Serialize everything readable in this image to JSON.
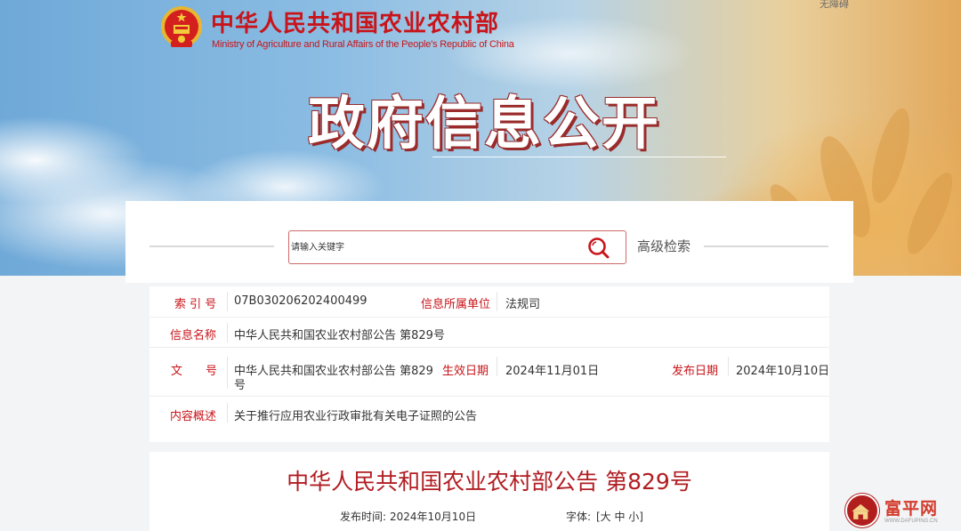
{
  "header": {
    "accessibility_link": "无障碍",
    "logo_cn": "中华人民共和国农业农村部",
    "logo_en": "Ministry of Agriculture and Rural Affairs of the People's Republic of China",
    "banner_title": "政府信息公开"
  },
  "search": {
    "placeholder": "请输入关键字",
    "advanced_label": "高级检索"
  },
  "info": {
    "index_label": "索 引 号",
    "index_value": "07B030206202400499",
    "unit_label": "信息所属单位",
    "unit_value": "法规司",
    "name_label": "信息名称",
    "name_value": "中华人民共和国农业农村部公告 第829号",
    "doc_label": "文　　号",
    "doc_value_line1": "中华人民共和国农业农村部公告 第829",
    "doc_value_line2": "号",
    "effective_label": "生效日期",
    "effective_value": "2024年11月01日",
    "publish_label": "发布日期",
    "publish_value": "2024年10月10日",
    "summary_label": "内容概述",
    "summary_value": "关于推行应用农业行政审批有关电子证照的公告"
  },
  "article": {
    "title": "中华人民共和国农业农村部公告 第829号",
    "pub_time_label": "发布时间:",
    "pub_time_value": "2024年10月10日",
    "font_label": "字体:",
    "font_controls": "[大 中 小]"
  },
  "watermark": {
    "text": "富平网",
    "url": "WWW.DAFUPING.CN"
  },
  "colors": {
    "brand_red": "#c8141a",
    "title_red": "#b11d22"
  }
}
